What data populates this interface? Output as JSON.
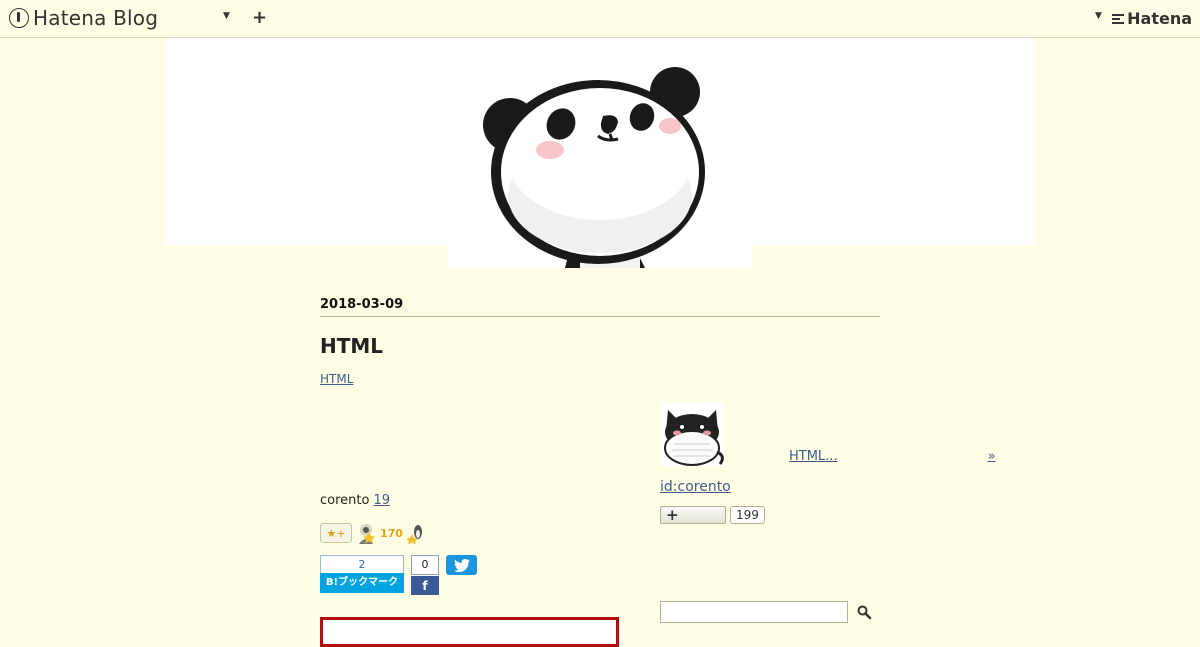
{
  "topbar": {
    "logo_text": "Hatena Blog",
    "brand": "Hatena"
  },
  "entry": {
    "date": "2018-03-09",
    "title": "HTML",
    "category": "HTML",
    "author": "corento",
    "time_link": "19",
    "star_count": "170",
    "bookmark_count": "2",
    "bookmark_label": "B!ブックマーク",
    "facebook_count": "0"
  },
  "sidebar": {
    "link_text": "HTML...",
    "link_arrow": "»",
    "profile_id": "id:corento",
    "subscriber_count": "199",
    "search_placeholder": ""
  },
  "colors": {
    "background": "#fffde4",
    "link": "#3d5c8c",
    "hatena_bookmark": "#00a4de",
    "facebook": "#3b5998",
    "twitter": "#1b95e0",
    "star": "#e1a71a",
    "accent_box": "#b10f14"
  }
}
